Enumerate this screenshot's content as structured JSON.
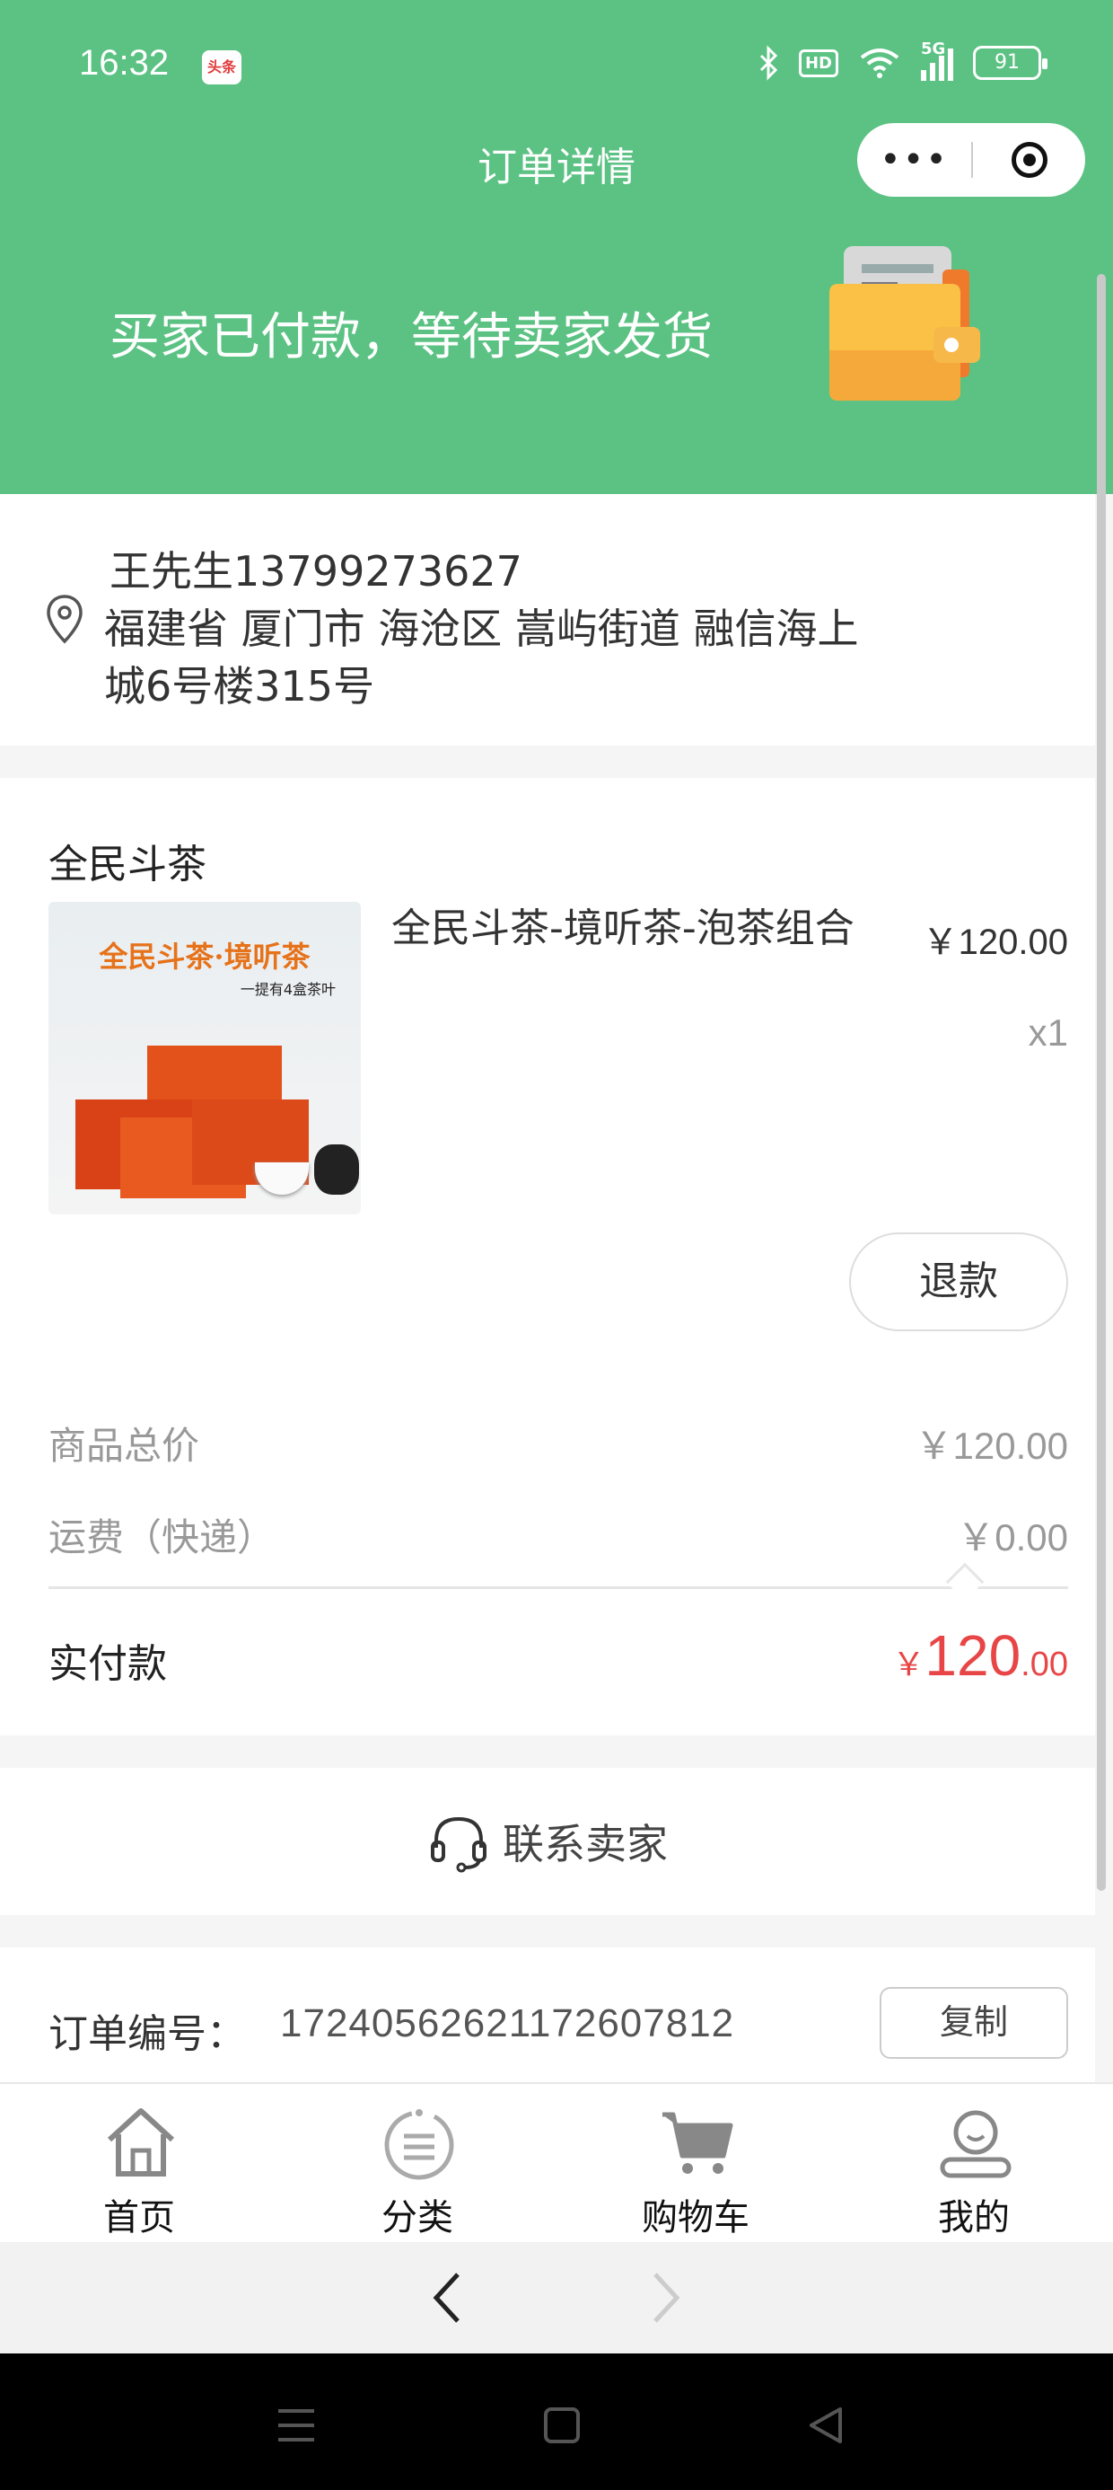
{
  "status_bar": {
    "time": "16:32",
    "app_badge": "头条",
    "hd": "HD",
    "network": "5G",
    "battery": "91"
  },
  "nav": {
    "title": "订单详情",
    "more": "•••"
  },
  "order_status": "买家已付款，等待卖家发货",
  "address": {
    "name_phone": "王先生13799273627",
    "detail": "福建省 厦门市 海沧区 嵩屿街道  融信海上城6号楼315号"
  },
  "goods": {
    "shop": "全民斗茶",
    "name": "全民斗茶-境听茶-泡茶组合",
    "price": "￥120.00",
    "qty": "x1",
    "image_title": "全民斗茶·境听茶",
    "image_sub": "一提有4盒茶叶",
    "refund": "退款"
  },
  "summary": {
    "subtotal_label": "商品总价",
    "subtotal": "￥120.00",
    "shipping_label": "运费（快递）",
    "shipping": "￥0.00",
    "paid_label": "实付款",
    "paid_currency": "￥",
    "paid_int": "120",
    "paid_dec": ".00"
  },
  "contact": {
    "label": "联系卖家",
    "icon": "headset-icon"
  },
  "order": {
    "number_label": "订单编号：",
    "number": "17240562621172607812",
    "copy": "复制"
  },
  "tabbar": [
    {
      "label": "首页",
      "icon": "home-icon"
    },
    {
      "label": "分类",
      "icon": "category-icon"
    },
    {
      "label": "购物车",
      "icon": "cart-icon"
    },
    {
      "label": "我的",
      "icon": "user-icon"
    }
  ],
  "colors": {
    "brand": "#5bc283",
    "price_red": "#e84646"
  }
}
